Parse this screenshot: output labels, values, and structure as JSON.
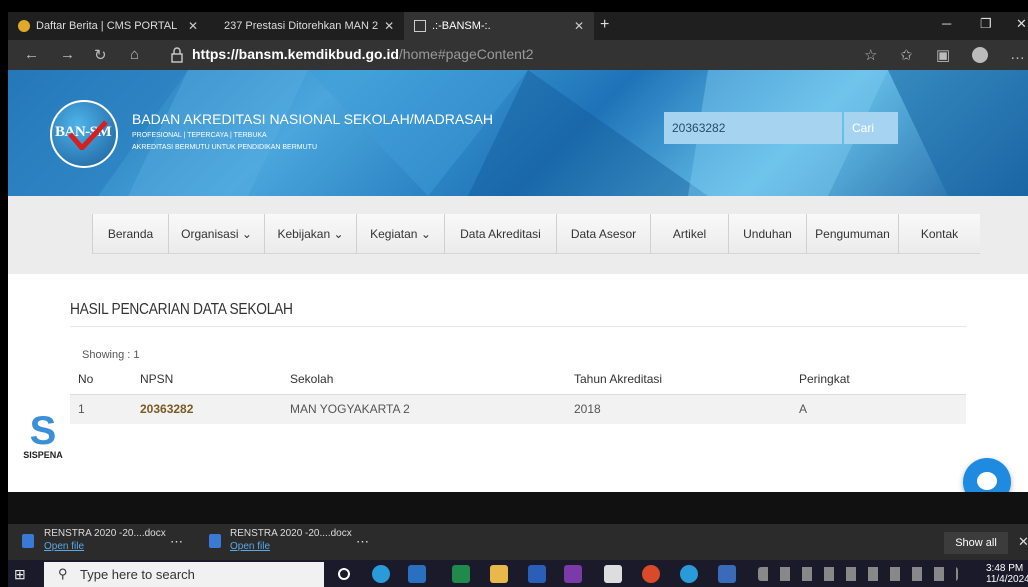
{
  "browser": {
    "tabs": [
      {
        "title": "Daftar Berita | CMS PORTAL"
      },
      {
        "title": "237 Prestasi Ditorehkan MAN 2"
      },
      {
        "title": ".:-BANSM-:."
      }
    ],
    "url_host": "https://bansm.kemdikbud.go.id",
    "url_path": "/home#pageContent2"
  },
  "header": {
    "logo_text": "BAN-SM",
    "title": "BADAN AKREDITASI NASIONAL SEKOLAH/MADRASAH",
    "tagline1": "PROFESIONAL | TEPERCAYA | TERBUKA",
    "tagline2": "AKREDITASI BERMUTU UNTUK PENDIDIKAN BERMUTU",
    "search_value": "20363282",
    "search_button": "Cari"
  },
  "menu": {
    "items": [
      {
        "label": "Beranda"
      },
      {
        "label": "Organisasi ⌄"
      },
      {
        "label": "Kebijakan ⌄"
      },
      {
        "label": "Kegiatan ⌄"
      },
      {
        "label": "Data Akreditasi"
      },
      {
        "label": "Data Asesor"
      },
      {
        "label": "Artikel"
      },
      {
        "label": "Unduhan"
      },
      {
        "label": "Pengumuman"
      },
      {
        "label": "Kontak"
      }
    ]
  },
  "results": {
    "title": "HASIL PENCARIAN DATA SEKOLAH",
    "showing": "Showing : 1",
    "columns": [
      "No",
      "NPSN",
      "Sekolah",
      "Tahun Akreditasi",
      "Peringkat"
    ],
    "rows": [
      {
        "no": "1",
        "npsn": "20363282",
        "sekolah": "MAN YOGYAKARTA 2",
        "tahun": "2018",
        "peringkat": "A"
      }
    ]
  },
  "sispena": {
    "letter": "S",
    "label": "SISPENA"
  },
  "downloads": [
    {
      "name": "RENSTRA 2020 -20....docx",
      "action": "Open file"
    },
    {
      "name": "RENSTRA 2020 -20....docx",
      "action": "Open file"
    }
  ],
  "download_bar": {
    "show_all": "Show all"
  },
  "taskbar": {
    "search_placeholder": "Type here to search",
    "time": "3:48 PM",
    "date": "11/4/2024"
  }
}
